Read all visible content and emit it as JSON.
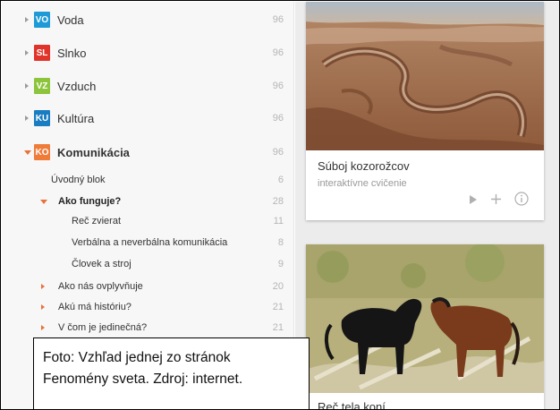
{
  "sidebar": {
    "top_items": [
      {
        "badge": "VO",
        "badge_color": "#1e9bd7",
        "label": "Voda",
        "count": "96",
        "expanded": false
      },
      {
        "badge": "SL",
        "badge_color": "#e0342b",
        "label": "Slnko",
        "count": "96",
        "expanded": false
      },
      {
        "badge": "VZ",
        "badge_color": "#8cc43c",
        "label": "Vzduch",
        "count": "96",
        "expanded": false
      },
      {
        "badge": "KU",
        "badge_color": "#1a7dc2",
        "label": "Kultúra",
        "count": "96",
        "expanded": false
      },
      {
        "badge": "KO",
        "badge_color": "#f07c3a",
        "label": "Komunikácia",
        "count": "96",
        "expanded": true
      }
    ],
    "sub_items": [
      {
        "label": "Úvodný blok",
        "count": "6"
      },
      {
        "label": "Ako funguje?",
        "count": "28"
      },
      {
        "label": "Reč zvierat",
        "count": "11"
      },
      {
        "label": "Verbálna a neverbálna komunikácia",
        "count": "8"
      },
      {
        "label": "Človek a stroj",
        "count": "9"
      },
      {
        "label": "Ako nás ovplyvňuje",
        "count": "20"
      },
      {
        "label": "Akú má históriu?",
        "count": "21"
      },
      {
        "label": "V čom je jedinečná?",
        "count": "21"
      }
    ]
  },
  "cards": [
    {
      "title": "Súboj kozorožcov",
      "subtitle": "interaktívne cvičenie"
    },
    {
      "title": "Reč tela koní"
    }
  ],
  "caption": {
    "line1": "Foto: Vzhľad jednej zo stránok",
    "line2": "Fenomény sveta. Zdroj: internet."
  },
  "colors": {
    "accent": "#e8733a",
    "sidebar_bg": "#f7f7f7",
    "cards_bg": "#ececec"
  },
  "icons": [
    "chevron-right-icon",
    "chevron-down-icon",
    "play-icon",
    "plus-icon",
    "info-icon"
  ]
}
